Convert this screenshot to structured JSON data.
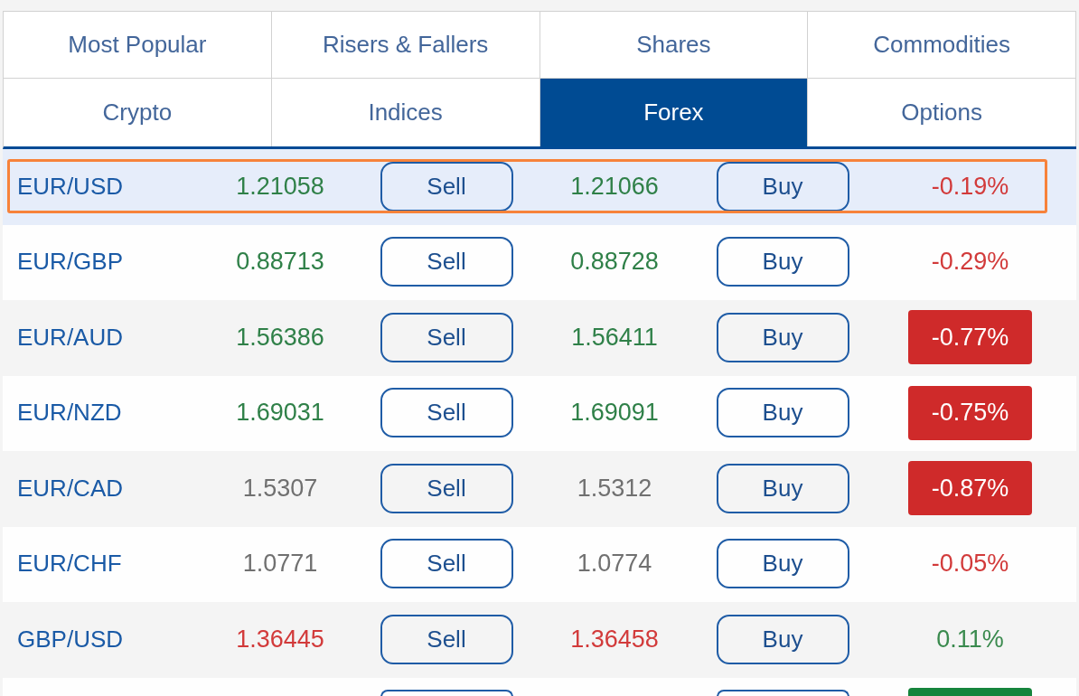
{
  "tabs": [
    {
      "label": "Most Popular",
      "selected": false
    },
    {
      "label": "Risers & Fallers",
      "selected": false
    },
    {
      "label": "Shares",
      "selected": false
    },
    {
      "label": "Commodities",
      "selected": false
    },
    {
      "label": "Crypto",
      "selected": false
    },
    {
      "label": "Indices",
      "selected": false
    },
    {
      "label": "Forex",
      "selected": true
    },
    {
      "label": "Options",
      "selected": false
    }
  ],
  "rows": [
    {
      "kind": "quote",
      "selected": true,
      "pair": "EUR/USD",
      "sell_price": "1.21058",
      "sell_label": "Sell",
      "buy_price": "1.21066",
      "buy_label": "Buy",
      "price_rising": true,
      "price_falling": false,
      "change": "-0.19%",
      "gain": false,
      "badge": false
    },
    {
      "kind": "quote",
      "selected": false,
      "pair": "EUR/GBP",
      "sell_price": "0.88713",
      "sell_label": "Sell",
      "buy_price": "0.88728",
      "buy_label": "Buy",
      "price_rising": true,
      "price_falling": false,
      "change": "-0.29%",
      "gain": false,
      "badge": false
    },
    {
      "kind": "quote",
      "selected": false,
      "pair": "EUR/AUD",
      "sell_price": "1.56386",
      "sell_label": "Sell",
      "buy_price": "1.56411",
      "buy_label": "Buy",
      "price_rising": true,
      "price_falling": false,
      "change": "-0.77%",
      "gain": false,
      "badge": true
    },
    {
      "kind": "quote",
      "selected": false,
      "pair": "EUR/NZD",
      "sell_price": "1.69031",
      "sell_label": "Sell",
      "buy_price": "1.69091",
      "buy_label": "Buy",
      "price_rising": true,
      "price_falling": false,
      "change": "-0.75%",
      "gain": false,
      "badge": true
    },
    {
      "kind": "quote",
      "selected": false,
      "pair": "EUR/CAD",
      "sell_price": "1.5307",
      "sell_label": "Sell",
      "buy_price": "1.5312",
      "buy_label": "Buy",
      "price_rising": false,
      "price_falling": false,
      "change": "-0.87%",
      "gain": false,
      "badge": true
    },
    {
      "kind": "quote",
      "selected": false,
      "pair": "EUR/CHF",
      "sell_price": "1.0771",
      "sell_label": "Sell",
      "buy_price": "1.0774",
      "buy_label": "Buy",
      "price_rising": false,
      "price_falling": false,
      "change": "-0.05%",
      "gain": false,
      "badge": false
    },
    {
      "kind": "quote",
      "selected": false,
      "pair": "GBP/USD",
      "sell_price": "1.36445",
      "sell_label": "Sell",
      "buy_price": "1.36458",
      "buy_label": "Buy",
      "price_rising": false,
      "price_falling": true,
      "change": "0.11%",
      "gain": true,
      "badge": false
    },
    {
      "kind": "cut_off",
      "selected": false,
      "gain": true,
      "badge": true
    }
  ]
}
